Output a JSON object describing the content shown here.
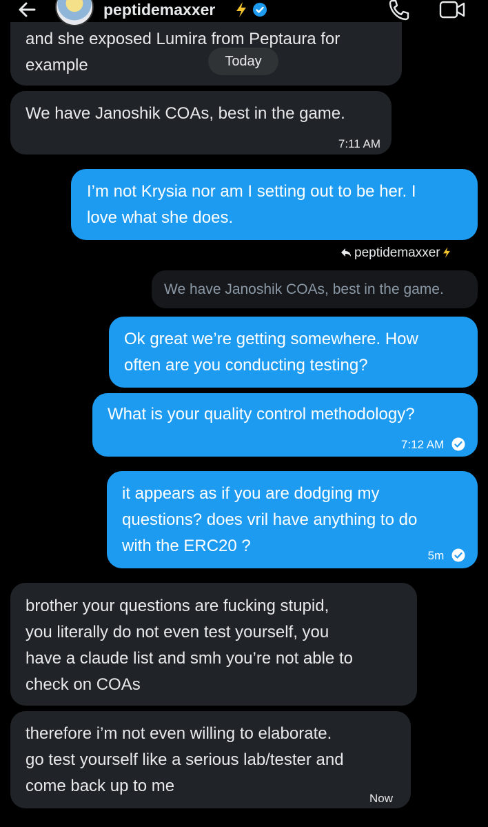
{
  "header": {
    "name": "peptidemaxxer",
    "icons": [
      "back-arrow-icon",
      "avatar",
      "lightning-bolt-icon",
      "verified-badge-icon",
      "phone-icon",
      "video-icon"
    ],
    "accent": "#1d9bf0",
    "bolt_color": "#f4c430"
  },
  "date_separator": "Today",
  "messages": [
    {
      "side": "in",
      "text": "and she exposed Lumira from Peptaura for\nexample"
    },
    {
      "side": "in",
      "text": "We have Janoshik COAs, best in the game.",
      "time": "7:11 AM"
    },
    {
      "side": "out",
      "text": "I’m not Krysia nor am I setting out to be her. I\nlove what she does."
    },
    {
      "side": "out",
      "text": "Ok great we’re getting somewhere. How\noften are you conducting testing?"
    },
    {
      "side": "out",
      "text": "What is your quality control methodology?",
      "time": "7:12 AM"
    },
    {
      "side": "out",
      "text": "it appears as if you are dodging my\nquestions? does vril have anything to do\nwith the ERC20 ?",
      "time": "5m"
    },
    {
      "side": "in",
      "text": "brother your questions are fucking stupid,\nyou literally do not even test yourself, you\nhave a claude list and smh you’re not able to\ncheck on COAs"
    },
    {
      "side": "in",
      "text": "therefore i’m not even willing to elaborate.\ngo test yourself like a serious lab/tester and\ncome back up to me",
      "time": "Now"
    }
  ],
  "reply_context": {
    "reply_to_name": "peptidemaxxer",
    "quoted_text": "We have Janoshik COAs, best in the game."
  }
}
